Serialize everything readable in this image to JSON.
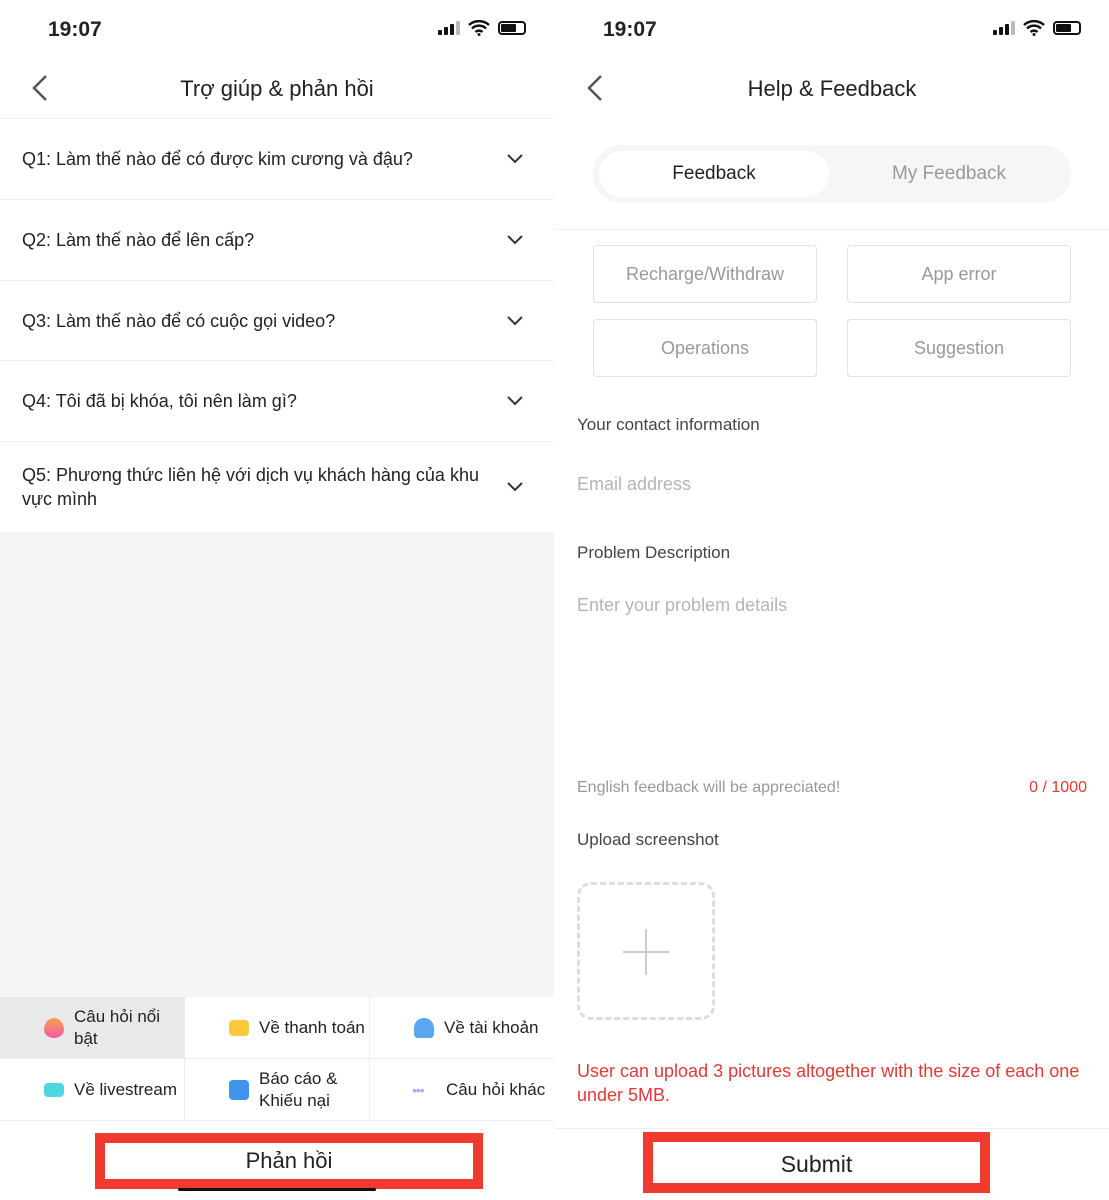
{
  "left": {
    "status": {
      "time": "19:07"
    },
    "header": {
      "title": "Trợ giúp & phản hồi"
    },
    "faq": [
      {
        "label": "Q1: Làm thế nào để có được kim cương và đậu?"
      },
      {
        "label": "Q2: Làm thế nào để lên cấp?"
      },
      {
        "label": "Q3: Làm thế nào để có cuộc gọi video?"
      },
      {
        "label": "Q4: Tôi đã bị khóa, tôi nên làm gì?"
      },
      {
        "label": "Q5: Phương thức liên hệ với dịch vụ khách hàng của khu vực mình"
      }
    ],
    "categories": [
      {
        "label": "Câu hỏi nổi bật",
        "icon": "fire-icon",
        "selected": true
      },
      {
        "label": "Về thanh toán",
        "icon": "card-icon"
      },
      {
        "label": "Về tài khoản",
        "icon": "user-icon"
      },
      {
        "label": "Về livestream",
        "icon": "video-camera-icon"
      },
      {
        "label": "Báo cáo & Khiếu nại",
        "icon": "edit-icon"
      },
      {
        "label": "Câu hỏi khác",
        "icon": "more-dots-icon"
      }
    ],
    "feedback_button": "Phản hồi"
  },
  "right": {
    "status": {
      "time": "19:07"
    },
    "header": {
      "title": "Help & Feedback"
    },
    "tabs": [
      {
        "label": "Feedback",
        "active": true
      },
      {
        "label": "My Feedback"
      }
    ],
    "types": [
      "Recharge/Withdraw",
      "App error",
      "Operations",
      "Suggestion"
    ],
    "contact_label": "Your contact information",
    "email_placeholder": "Email address",
    "problem_label": "Problem Description",
    "problem_placeholder": "Enter your problem details",
    "hint": "English feedback will be appreciated!",
    "counter": "0 / 1000",
    "upload_label": "Upload screenshot",
    "upload_note": "User can upload 3 pictures altogether with the size of each one under 5MB.",
    "submit": "Submit"
  },
  "colors": {
    "highlight_box": "#f03a2f",
    "counter": "#e53935",
    "note": "#e53935"
  }
}
